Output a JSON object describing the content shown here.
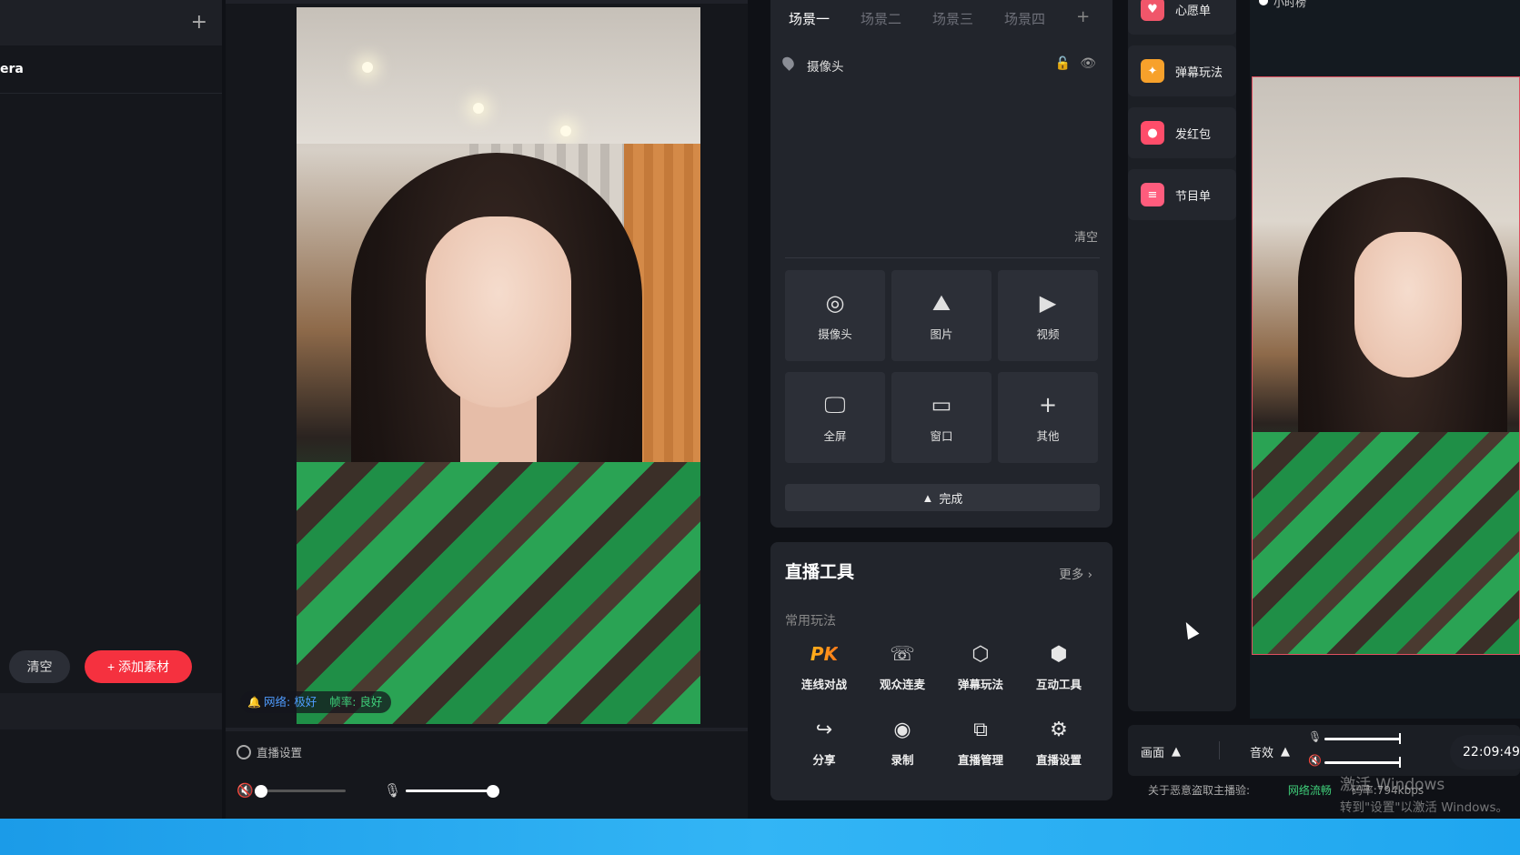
{
  "left": {
    "camera_label": "era",
    "clear_label": "清空",
    "add_label": "+ 添加素材"
  },
  "preview": {
    "net_label": "网络:",
    "net_value": "极好",
    "fps_label": "帧率:",
    "fps_value": "良好",
    "live_settings_label": "直播设置",
    "speaker_volume": 0.03,
    "mic_volume": 1.0
  },
  "scenes": {
    "tabs": [
      "场景一",
      "场景二",
      "场景三",
      "场景四"
    ],
    "active_tab": 0,
    "camera_item": "摄像头",
    "clear_label": "清空",
    "sources": [
      {
        "label": "摄像头",
        "icon": "camera-icon"
      },
      {
        "label": "图片",
        "icon": "image-icon"
      },
      {
        "label": "视频",
        "icon": "video-icon"
      },
      {
        "label": "全屏",
        "icon": "monitor-icon"
      },
      {
        "label": "窗口",
        "icon": "window-icon"
      },
      {
        "label": "其他",
        "icon": "plus-icon"
      }
    ],
    "done_label": "完成"
  },
  "tools": {
    "title": "直播工具",
    "more_label": "更多",
    "subtitle": "常用玩法",
    "items": [
      {
        "label": "连线对战",
        "icon": "pk-icon"
      },
      {
        "label": "观众连麦",
        "icon": "phone-icon"
      },
      {
        "label": "弹幕玩法",
        "icon": "shield-x-icon"
      },
      {
        "label": "互动工具",
        "icon": "hexagon-y-icon"
      },
      {
        "label": "分享",
        "icon": "share-icon"
      },
      {
        "label": "录制",
        "icon": "record-icon"
      },
      {
        "label": "直播管理",
        "icon": "manage-icon"
      },
      {
        "label": "直播设置",
        "icon": "hex-gear-icon"
      }
    ],
    "pk_text": "PK"
  },
  "features": [
    {
      "label": "心愿单",
      "icon": "wish-icon",
      "color": "#f0566a"
    },
    {
      "label": "弹幕玩法",
      "icon": "danmu-icon",
      "color": "#f7a12b"
    },
    {
      "label": "发红包",
      "icon": "redpacket-icon",
      "color": "#ff4d6a"
    },
    {
      "label": "节目单",
      "icon": "program-icon",
      "color": "#ff5c7d"
    }
  ],
  "right": {
    "top_text": "小时榜",
    "picture_label": "画面",
    "sound_label": "音效",
    "time": "22:09:49",
    "status_notice": "关于恶意盗取主播验:",
    "status_net": "网络流畅",
    "status_rate": "码率:794kbps"
  },
  "watermark": {
    "line1": "激活 Windows",
    "line2": "转到\"设置\"以激活 Windows。"
  }
}
